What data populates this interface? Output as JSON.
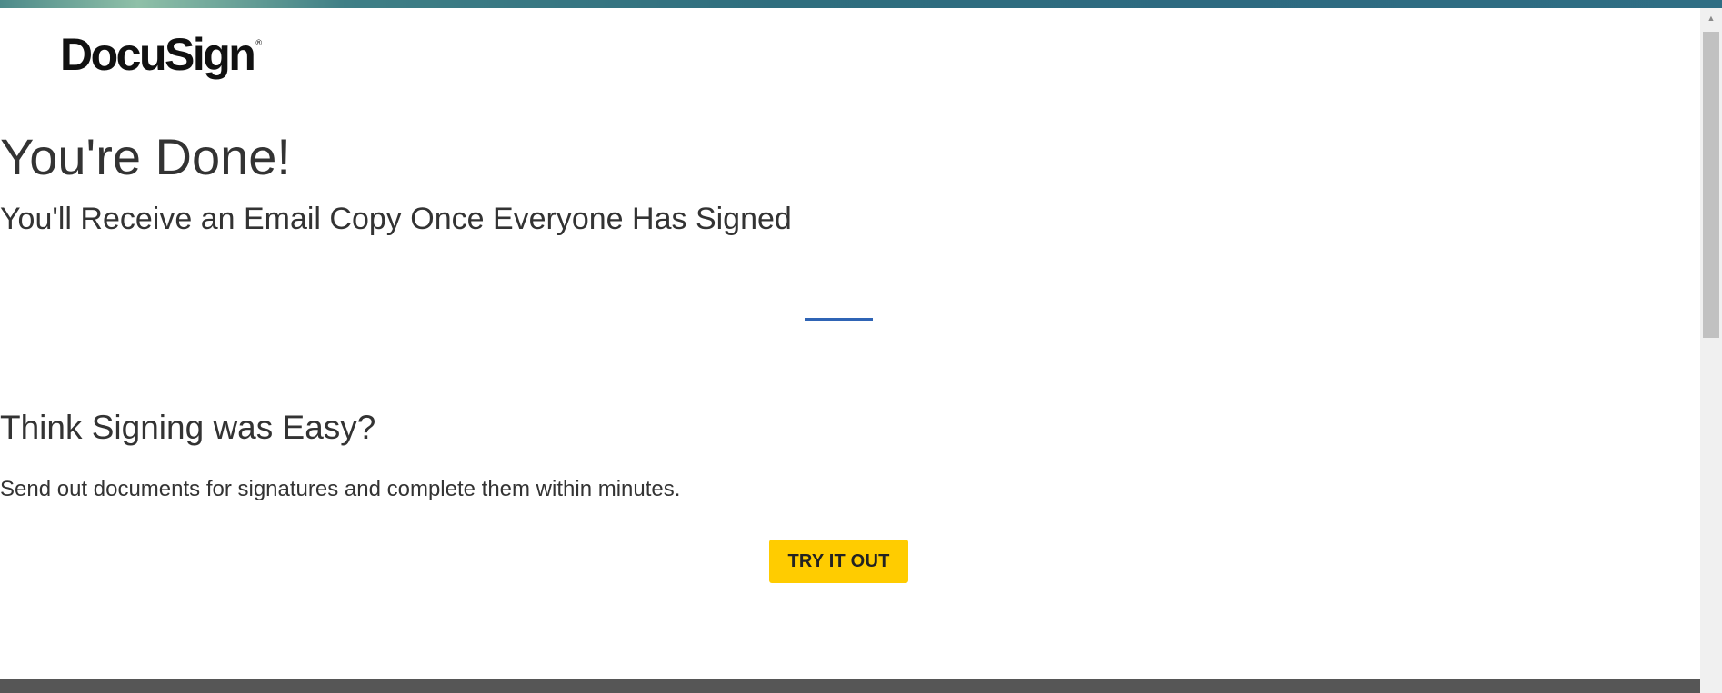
{
  "brand": {
    "logo_text": "DocuSign",
    "logo_mark": "®"
  },
  "completion": {
    "title": "You're Done!",
    "subtitle": "You'll Receive an Email Copy Once Everyone Has Signed"
  },
  "promo": {
    "heading": "Think Signing was Easy?",
    "text": "Send out documents for signatures and complete them within minutes.",
    "button_label": "TRY IT OUT"
  },
  "scrollbar": {
    "up_arrow": "▲"
  },
  "colors": {
    "accent_divider": "#2f64b5",
    "cta": "#ffcc00",
    "footer": "#565656",
    "text": "#333333"
  },
  "icons": {
    "scroll_up": "scroll-up-arrow-icon"
  }
}
